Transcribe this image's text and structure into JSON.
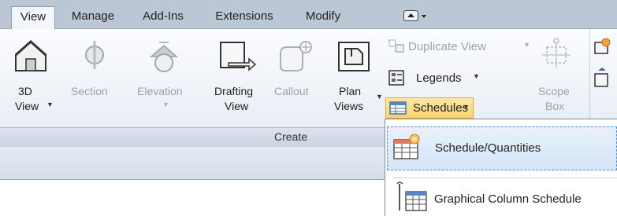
{
  "tabs": [
    {
      "label": "View",
      "active": true
    },
    {
      "label": "Manage",
      "active": false
    },
    {
      "label": "Add-Ins",
      "active": false
    },
    {
      "label": "Extensions",
      "active": false
    },
    {
      "label": "Modify",
      "active": false
    }
  ],
  "ribbon": {
    "view3d": {
      "line1": "3D",
      "line2": "View"
    },
    "section": {
      "label": "Section"
    },
    "elevation": {
      "label": "Elevation"
    },
    "drafting": {
      "line1": "Drafting",
      "line2": "View"
    },
    "callout": {
      "label": "Callout"
    },
    "plan": {
      "line1": "Plan",
      "line2": "Views"
    },
    "duplicate": {
      "label": "Duplicate View"
    },
    "legends": {
      "label": "Legends"
    },
    "schedules": {
      "label": "Schedules"
    },
    "scopebox": {
      "line1": "Scope",
      "line2": "Box"
    },
    "panel_label": "Create"
  },
  "dropdown": {
    "items": [
      {
        "label": "Schedule/Quantities"
      },
      {
        "label": "Graphical Column Schedule"
      }
    ]
  },
  "colors": {
    "tabbar": "#bcc7d6",
    "highlight": "#f9d46d",
    "selection": "#d4e5f7"
  }
}
